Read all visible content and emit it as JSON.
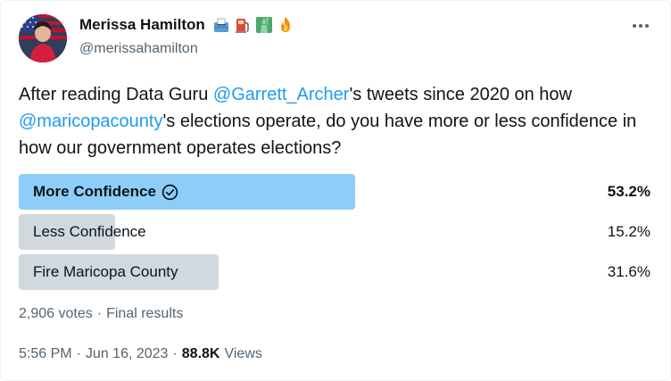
{
  "author": {
    "display_name": "Merissa Hamilton",
    "handle": "@merissahamilton",
    "emojis": [
      "ballot-box-icon",
      "fuel-pump-icon",
      "statue-of-liberty-icon",
      "fire-icon"
    ]
  },
  "tweet": {
    "text_part1": "After reading Data Guru ",
    "mention1": "@Garrett_Archer",
    "text_part2": "'s tweets since 2020 on how ",
    "mention2": "@maricopacounty",
    "text_part3": "'s elections operate, do you have more or less confidence in how our government operates elections?"
  },
  "poll": {
    "options": [
      {
        "label": "More Confidence",
        "percent_text": "53.2%",
        "percent": 53.2,
        "winner": true
      },
      {
        "label": "Less Confidence",
        "percent_text": "15.2%",
        "percent": 15.2,
        "winner": false
      },
      {
        "label": "Fire Maricopa County",
        "percent_text": "31.6%",
        "percent": 31.6,
        "winner": false
      }
    ],
    "votes": "2,906 votes",
    "separator": "·",
    "status": "Final results"
  },
  "meta": {
    "time": "5:56 PM",
    "separator": "·",
    "date": "Jun 16, 2023",
    "views_count": "88.8K",
    "views_label": "Views"
  },
  "colors": {
    "winner_bar": "#8ecdf8",
    "bar": "#cfd9de",
    "link": "#1d9bf0",
    "secondary_text": "#536471"
  }
}
